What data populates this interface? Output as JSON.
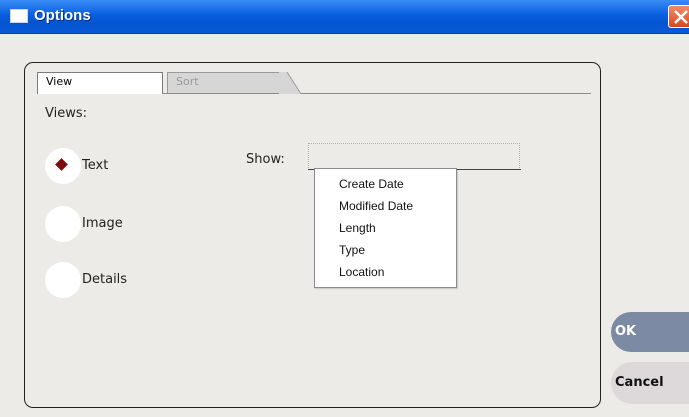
{
  "window": {
    "title": "Options"
  },
  "tabs": [
    {
      "label": "View",
      "active": true
    },
    {
      "label": "Sort",
      "active": false
    }
  ],
  "views": {
    "label": "Views:",
    "options": [
      {
        "label": "Text",
        "selected": true
      },
      {
        "label": "Image",
        "selected": false
      },
      {
        "label": "Details",
        "selected": false
      }
    ]
  },
  "show": {
    "label": "Show:",
    "value": "",
    "options": [
      "Create Date",
      "Modified Date",
      "Length",
      "Type",
      "Location"
    ]
  },
  "buttons": {
    "ok": "OK",
    "cancel": "Cancel"
  },
  "colors": {
    "titlebar": "#0a5fe0",
    "radio_selected": "#7a0c10",
    "ok_button": "#7c8ba3",
    "cancel_button": "#ddd9db"
  }
}
